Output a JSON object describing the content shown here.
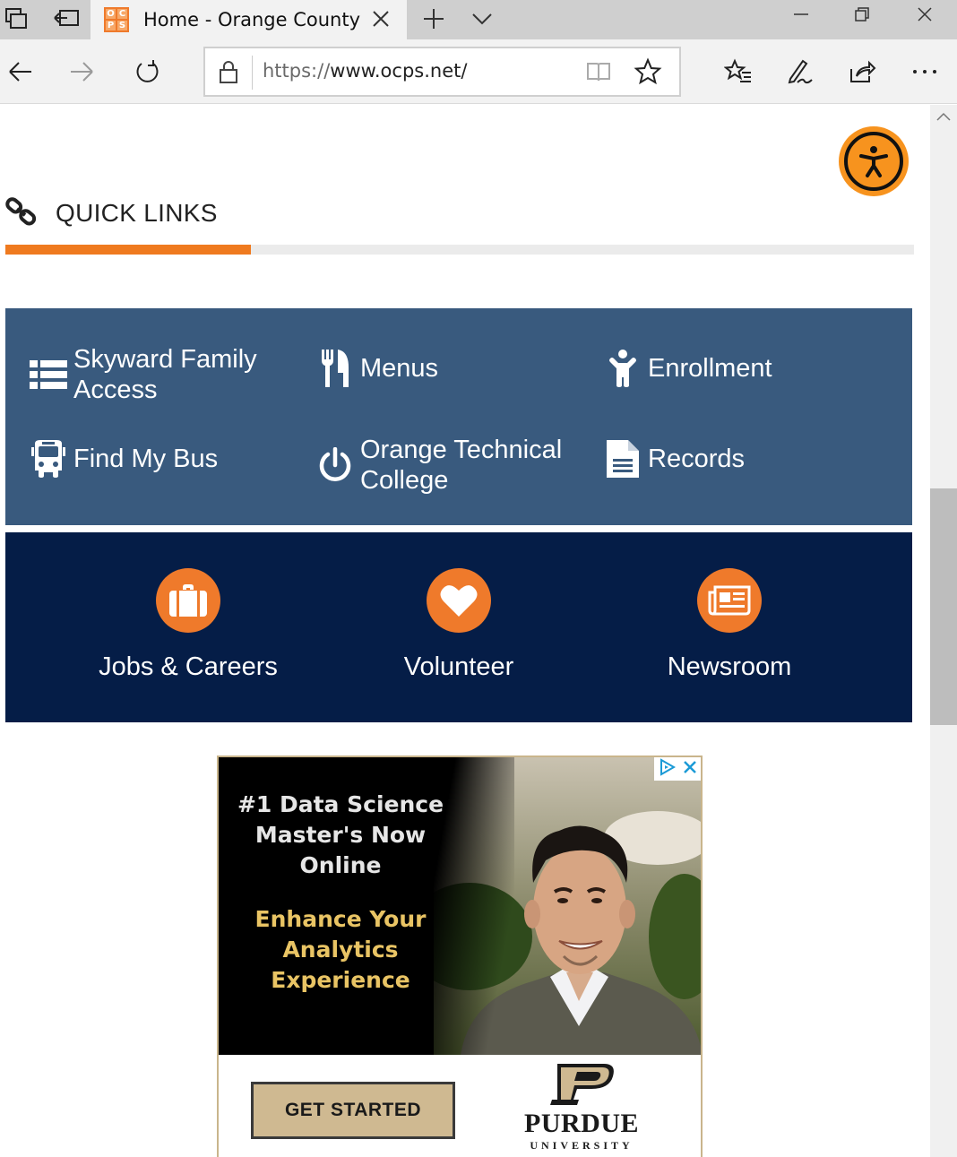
{
  "browser": {
    "tab_title": "Home - Orange County",
    "favicon_letters": [
      "O",
      "C",
      "P",
      "S"
    ],
    "url_protocol": "https://",
    "url_rest": "www.ocps.net/"
  },
  "page": {
    "quick_links_title": "QUICK LINKS",
    "quick_links_progress": 0.27,
    "links": [
      {
        "label": "Skyward Family Access",
        "icon": "list-icon"
      },
      {
        "label": "Menus",
        "icon": "utensils-icon"
      },
      {
        "label": "Enrollment",
        "icon": "child-icon"
      },
      {
        "label": "Find My Bus",
        "icon": "bus-icon"
      },
      {
        "label": "Orange Technical College",
        "icon": "power-icon"
      },
      {
        "label": "Records",
        "icon": "document-icon"
      }
    ],
    "promos": [
      {
        "label": "Jobs & Careers",
        "icon": "briefcase-icon"
      },
      {
        "label": "Volunteer",
        "icon": "heart-icon"
      },
      {
        "label": "Newsroom",
        "icon": "newspaper-icon"
      }
    ]
  },
  "ad": {
    "headline": "#1 Data Science Master's Now Online",
    "subhead": "Enhance Your Analytics Experience",
    "cta": "GET STARTED",
    "brand": "PURDUE",
    "brand_sub": "UNIVERSITY",
    "colors": {
      "gold": "#cfb991",
      "headline_gold": "#e9c464"
    }
  },
  "colors": {
    "accent_orange": "#ef7a1f",
    "links_bg": "#395a7e",
    "promo_bg": "#051d47"
  }
}
